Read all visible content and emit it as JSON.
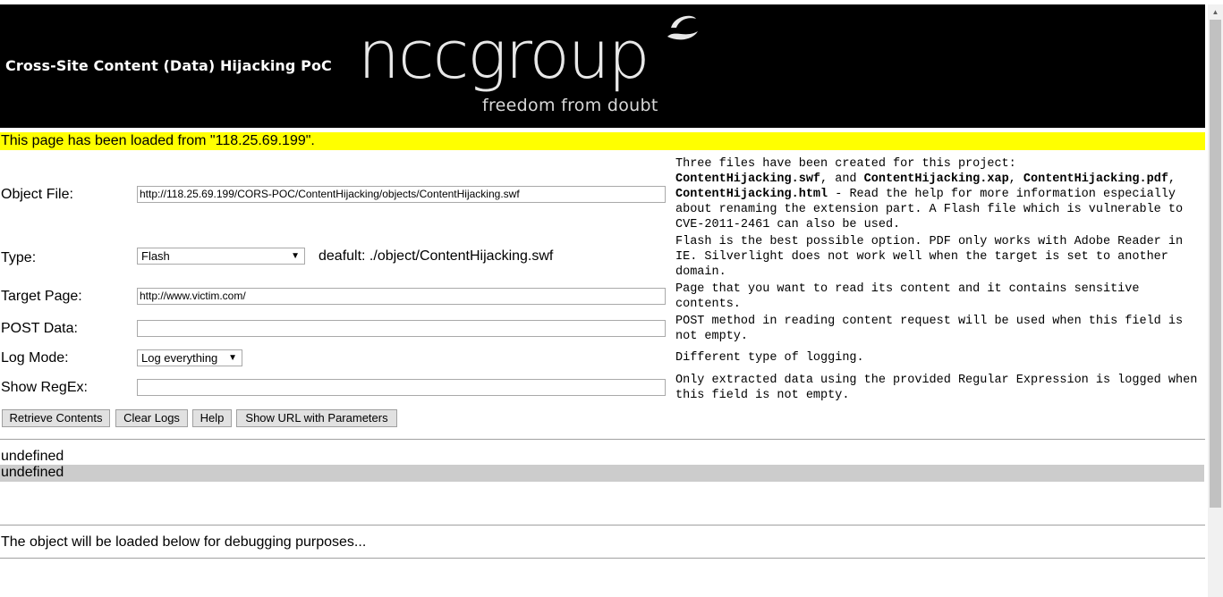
{
  "header": {
    "title": "Cross-Site Content (Data) Hijacking PoC",
    "logo_text": "nccgroup",
    "logo_tagline": "freedom from doubt"
  },
  "banner": {
    "text": "This page has been loaded from \"118.25.69.199\"."
  },
  "form": {
    "object_file_label": "Object File:",
    "object_file_value": "http://118.25.69.199/CORS-POC/ContentHijacking/objects/ContentHijacking.swf",
    "type_label": "Type:",
    "type_selected": "Flash",
    "type_default_note": "deafult: ./object/ContentHijacking.swf",
    "target_label": "Target Page:",
    "target_value": "http://www.victim.com/",
    "post_label": "POST Data:",
    "post_value": "",
    "log_label": "Log Mode:",
    "log_selected": "Log everything",
    "regex_label": "Show RegEx:",
    "regex_value": ""
  },
  "help": {
    "object_intro": "Three files have been created for this project:",
    "file_swf": "ContentHijacking.swf",
    "sep_and": ", and ",
    "file_xap": "ContentHijacking.xap",
    "sep_comma": ",",
    "file_pdf": "ContentHijacking.pdf",
    "sep_comma2": ", ",
    "file_html": "ContentHijacking.html",
    "object_tail": " - Read the help for more information especially about renaming the extension part. A Flash file which is vulnerable to CVE-2011-2461 can also be used.",
    "type": "Flash is the best possible option. PDF only works with Adobe Reader in IE. Silverlight does not work well when the target is set to another domain.",
    "target": "Page that you want to read its content and it contains sensitive contents.",
    "post": "POST method in reading content request will be used when this field is not empty.",
    "log": "Different type of logging.",
    "regex": "Only extracted data using the provided Regular Expression is logged when this field is not empty."
  },
  "buttons": {
    "retrieve": "Retrieve Contents",
    "clear": "Clear Logs",
    "help": "Help",
    "show_url": "Show URL with Parameters"
  },
  "log": {
    "lines": [
      "undefined",
      "undefined"
    ]
  },
  "debug": {
    "text": "The object will be loaded below for debugging purposes..."
  },
  "colors": {
    "header_bg": "#000000",
    "banner_bg": "#ffff00",
    "log_highlight": "#cccccc"
  },
  "icons": {
    "logo_mark": "wave-swoosh-icon",
    "dropdown": "dropdown-arrow-icon"
  }
}
